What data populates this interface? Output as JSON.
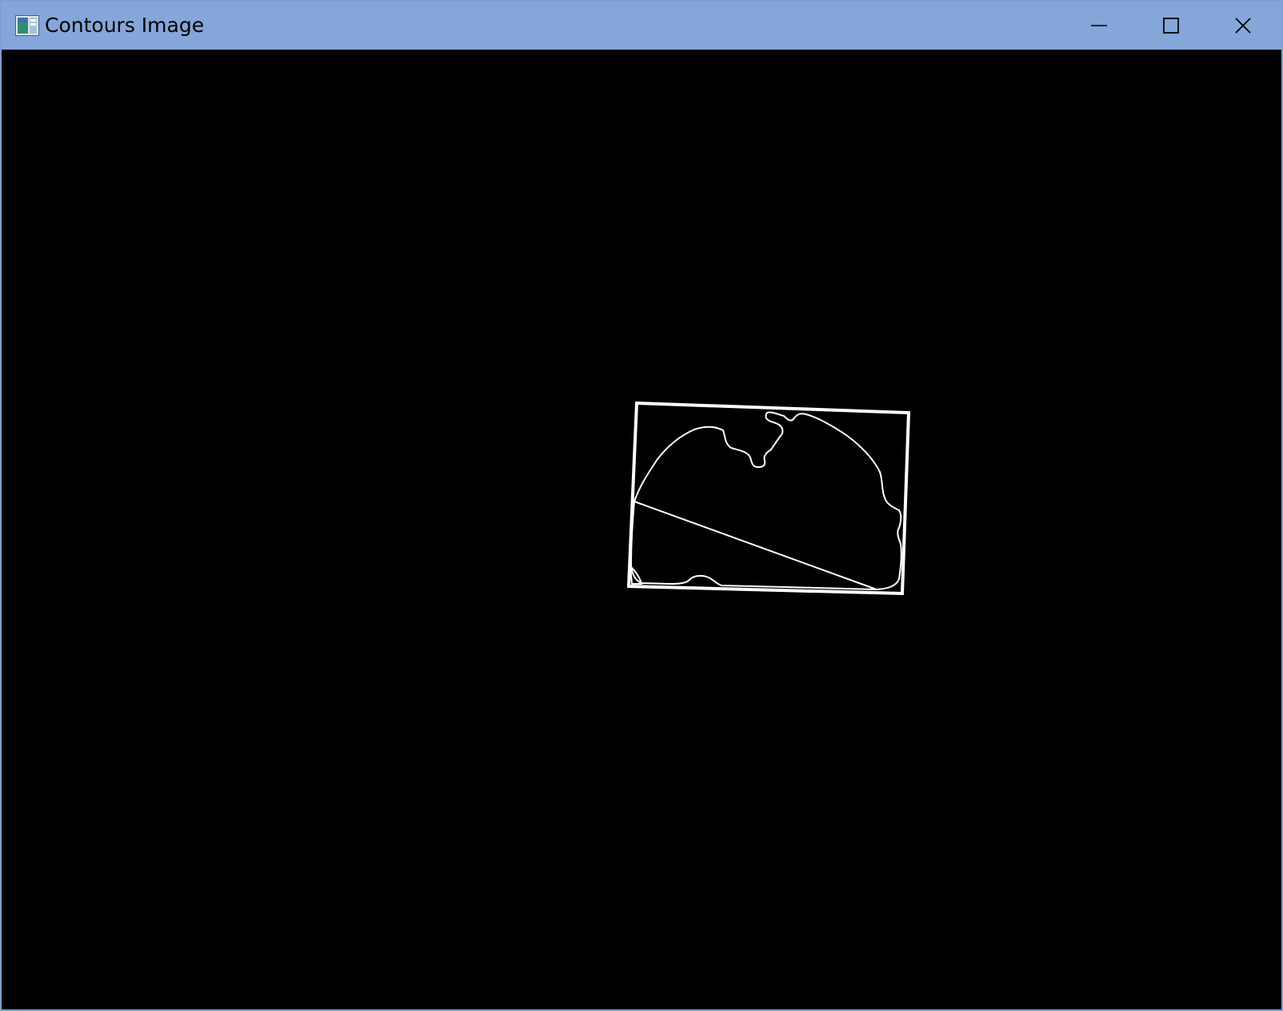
{
  "window": {
    "title": "Contours Image",
    "icon": "image-window-icon",
    "controls": {
      "minimize_icon": "minimize-icon",
      "maximize_icon": "maximize-icon",
      "close_icon": "close-icon"
    }
  },
  "canvas": {
    "background": "#000000",
    "stroke_color": "#ffffff"
  },
  "colors": {
    "titlebar": "#84a6d9",
    "border": "#7f9fd4"
  }
}
